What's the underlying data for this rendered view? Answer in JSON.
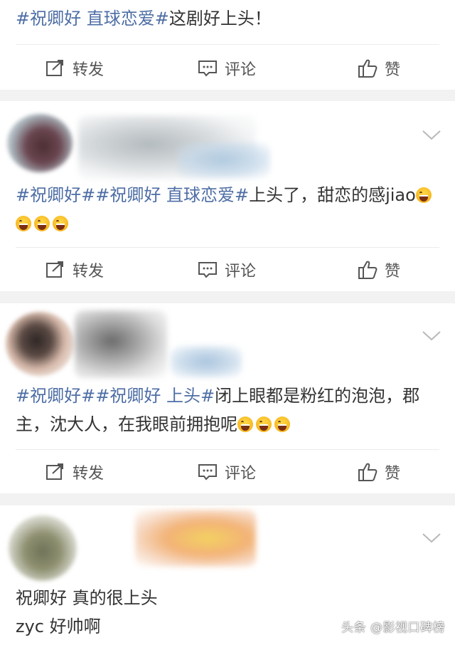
{
  "actions": {
    "forward": "转发",
    "comment": "评论",
    "like": "赞"
  },
  "post1": {
    "tag": "#祝卿好 直球恋爱#",
    "text": "这剧好上头！"
  },
  "post2": {
    "tag1": "#祝卿好#",
    "tag2": "#祝卿好 直球恋爱#",
    "text": "上头了，甜恋的感jiao"
  },
  "post3": {
    "tag1": "#祝卿好#",
    "tag2": "#祝卿好 上头#",
    "text": "闭上眼都是粉红的泡泡，郡主，沈大人，在我眼前拥抱呢"
  },
  "post4": {
    "line1": "祝卿好 真的很上头",
    "line2": "zyc 好帅啊"
  },
  "watermark": "头条 @影视口碑榜",
  "colors": {
    "tag": "#4e6ea5",
    "text": "#333333",
    "background": "#f2f2f2"
  },
  "icons": [
    "forward-icon",
    "comment-icon",
    "like-icon",
    "chevron-down-icon",
    "laugh-emoji"
  ]
}
